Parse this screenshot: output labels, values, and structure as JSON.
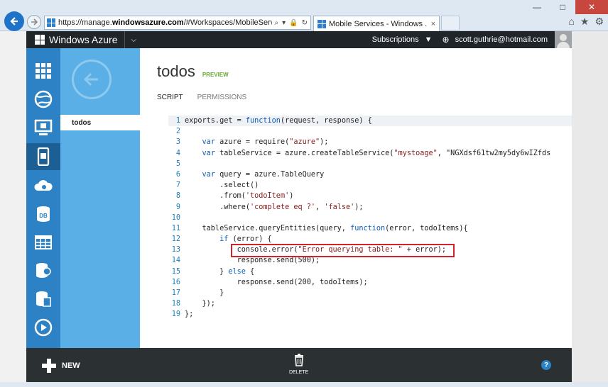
{
  "browser": {
    "url_prefix": "https://manage.",
    "url_domain": "windowsazure.com",
    "url_suffix": "/#Workspaces/MobileServicesExter",
    "tab_title": "Mobile Services - Windows ...",
    "tab_close": "×",
    "window_buttons": [
      "—",
      "□",
      "✕"
    ]
  },
  "topbar": {
    "brand": "Windows Azure",
    "subscriptions": "Subscriptions",
    "email": "scott.guthrie@hotmail.com"
  },
  "rail": {
    "items": [
      "all-items",
      "web-sites",
      "virtual-machines",
      "mobile-services",
      "cloud-services",
      "sql-databases",
      "storage",
      "hdinsight",
      "media-services"
    ],
    "db_label": "DB"
  },
  "panel": {
    "selected_item": "todos"
  },
  "main": {
    "title": "todos",
    "badge": "PREVIEW",
    "tabs": [
      {
        "label": "SCRIPT"
      },
      {
        "label": "PERMISSIONS"
      }
    ]
  },
  "code": {
    "lines": [
      "exports.get = function(request, response) {",
      "",
      "    var azure = require(\"azure\");",
      "    var tableService = azure.createTableService(\"mystoage\", \"NGXdsf61tw2my5dy6wIZfds",
      "",
      "    var query = azure.TableQuery",
      "        .select()",
      "        .from('todoItem')",
      "        .where('complete eq ?', 'false');",
      "",
      "    tableService.queryEntities(query, function(error, todoItems){",
      "        if (error) {",
      "            console.error(\"Error querying table: \" + error);",
      "            response.send(500);",
      "        } else {",
      "            response.send(200, todoItems);",
      "        }",
      "    });",
      "};"
    ]
  },
  "commandbar": {
    "new_label": "NEW",
    "delete_label": "DELETE",
    "help_label": "?"
  },
  "colors": {
    "accent": "#2c82c4",
    "panel": "#5ab0e6",
    "highlight_box": "#d1232a",
    "preview": "#6aa831"
  }
}
